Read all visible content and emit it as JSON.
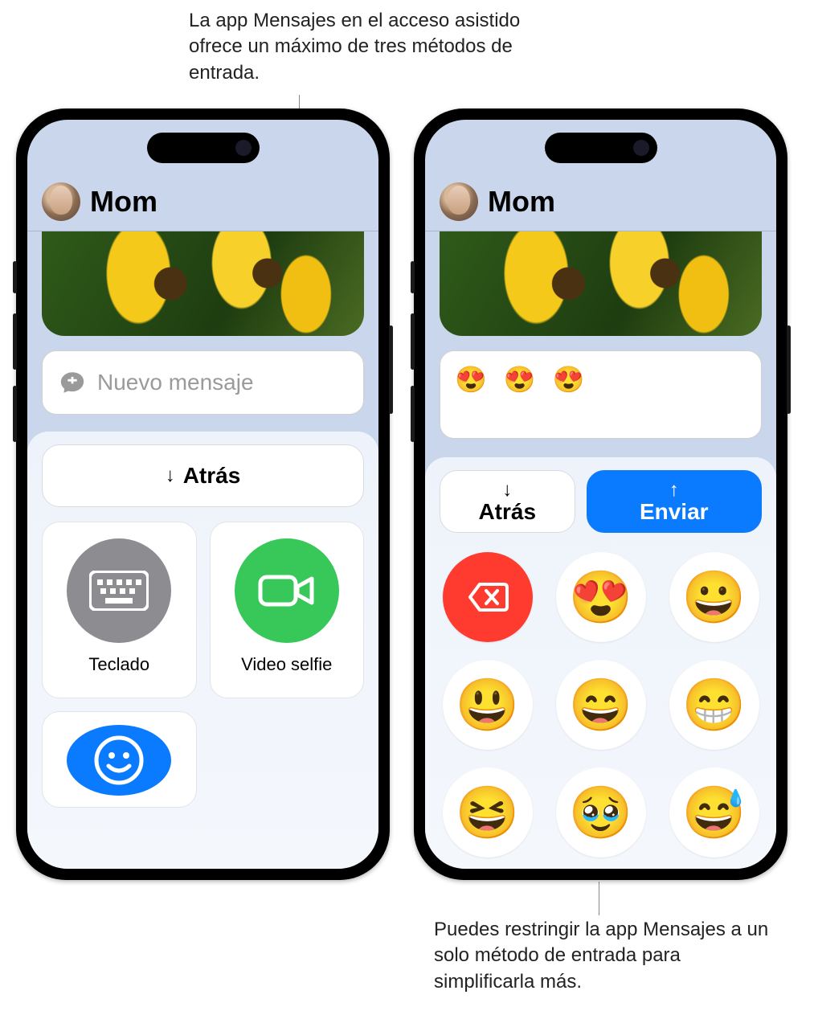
{
  "callouts": {
    "top": "La app Mensajes en el acceso asistido ofrece un máximo de tres métodos de entrada.",
    "bottom": "Puedes restringir la app Mensajes a un solo método de entrada para simplificarla más."
  },
  "left": {
    "contact": "Mom",
    "compose_placeholder": "Nuevo mensaje",
    "back_label": "Atrás",
    "tiles": {
      "keyboard": "Teclado",
      "video": "Video selfie"
    }
  },
  "right": {
    "contact": "Mom",
    "compose_value": "😍 😍 😍",
    "back_label": "Atrás",
    "send_label": "Enviar",
    "emoji_keys": [
      "delete",
      "😍",
      "😀",
      "😃",
      "😄",
      "😁",
      "😆",
      "🥹",
      "😅"
    ]
  }
}
